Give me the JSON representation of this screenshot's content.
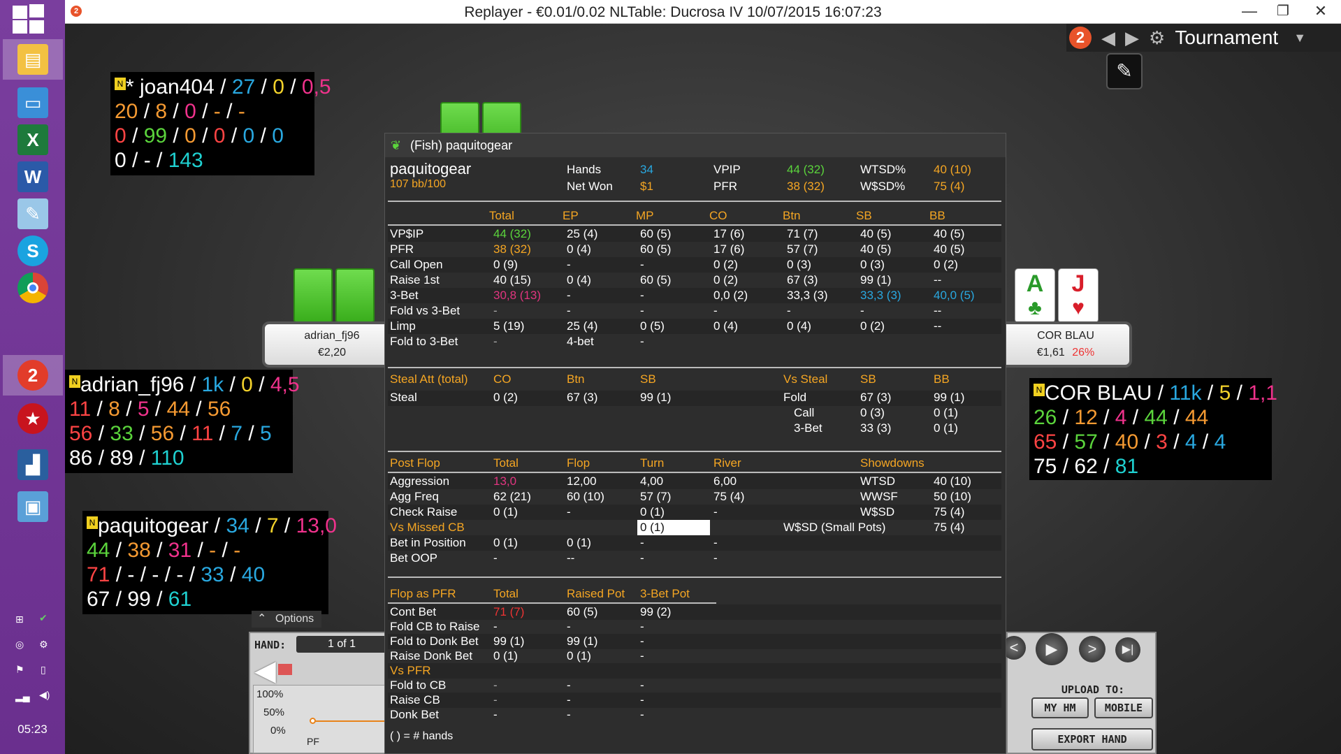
{
  "window": {
    "title": "Replayer - €0.01/0.02 NLTable: Ducrosa IV     10/07/2015 16:07:23",
    "minimize": "—",
    "restore": "❐",
    "close": "✕"
  },
  "taskbar": {
    "clock": "05:23",
    "apps": [
      "file-explorer-icon",
      "remote-desktop-icon",
      "excel-icon",
      "word-icon",
      "notepad-icon",
      "skype-icon",
      "chrome-icon",
      "holdem-manager-icon",
      "pokerstars-icon",
      "chart-app-icon",
      "photos-icon"
    ]
  },
  "toolbar": {
    "badge": "2",
    "mode": "Tournament"
  },
  "huds": {
    "joan": {
      "row1": [
        {
          "t": "* joan404",
          "c": "w"
        },
        {
          "t": " / ",
          "c": "w"
        },
        {
          "t": "27",
          "c": "b"
        },
        {
          "t": " / ",
          "c": "w"
        },
        {
          "t": "0",
          "c": "y"
        },
        {
          "t": " / ",
          "c": "w"
        },
        {
          "t": "0,5",
          "c": "p"
        }
      ],
      "row2": [
        {
          "t": "20",
          "c": "o"
        },
        {
          "t": " / ",
          "c": "w"
        },
        {
          "t": "8",
          "c": "o"
        },
        {
          "t": " / ",
          "c": "w"
        },
        {
          "t": "0",
          "c": "p"
        },
        {
          "t": " / ",
          "c": "w"
        },
        {
          "t": "-",
          "c": "o"
        },
        {
          "t": " / ",
          "c": "w"
        },
        {
          "t": "-",
          "c": "o"
        }
      ],
      "row3": [
        {
          "t": "0",
          "c": "r"
        },
        {
          "t": " / ",
          "c": "w"
        },
        {
          "t": "99",
          "c": "g"
        },
        {
          "t": " / ",
          "c": "w"
        },
        {
          "t": "0",
          "c": "o"
        },
        {
          "t": " / ",
          "c": "w"
        },
        {
          "t": "0",
          "c": "r"
        },
        {
          "t": " / ",
          "c": "w"
        },
        {
          "t": "0",
          "c": "b"
        },
        {
          "t": " / ",
          "c": "w"
        },
        {
          "t": "0",
          "c": "b"
        }
      ],
      "row4": [
        {
          "t": "0",
          "c": "w"
        },
        {
          "t": " / - / ",
          "c": "w"
        },
        {
          "t": "143",
          "c": "c"
        }
      ]
    },
    "adrian": {
      "row1": [
        {
          "t": "adrian_fj96",
          "c": "w"
        },
        {
          "t": " / ",
          "c": "w"
        },
        {
          "t": "1k",
          "c": "b"
        },
        {
          "t": " / ",
          "c": "w"
        },
        {
          "t": "0",
          "c": "y"
        },
        {
          "t": " / ",
          "c": "w"
        },
        {
          "t": "4,5",
          "c": "p"
        }
      ],
      "row2": [
        {
          "t": "11",
          "c": "r"
        },
        {
          "t": " / ",
          "c": "w"
        },
        {
          "t": "8",
          "c": "o"
        },
        {
          "t": " / ",
          "c": "w"
        },
        {
          "t": "5",
          "c": "p"
        },
        {
          "t": " / ",
          "c": "w"
        },
        {
          "t": "44",
          "c": "o"
        },
        {
          "t": " / ",
          "c": "w"
        },
        {
          "t": "56",
          "c": "o"
        }
      ],
      "row3": [
        {
          "t": "56",
          "c": "r"
        },
        {
          "t": " / ",
          "c": "w"
        },
        {
          "t": "33",
          "c": "g"
        },
        {
          "t": " / ",
          "c": "w"
        },
        {
          "t": "56",
          "c": "o"
        },
        {
          "t": " / ",
          "c": "w"
        },
        {
          "t": "11",
          "c": "r"
        },
        {
          "t": " / ",
          "c": "w"
        },
        {
          "t": "7",
          "c": "b"
        },
        {
          "t": " / ",
          "c": "w"
        },
        {
          "t": "5",
          "c": "b"
        }
      ],
      "row4": [
        {
          "t": "86",
          "c": "w"
        },
        {
          "t": " / ",
          "c": "w"
        },
        {
          "t": "89",
          "c": "w"
        },
        {
          "t": " / ",
          "c": "w"
        },
        {
          "t": "110",
          "c": "c"
        }
      ]
    },
    "paquito": {
      "row1": [
        {
          "t": "paquitogear",
          "c": "w"
        },
        {
          "t": " / ",
          "c": "w"
        },
        {
          "t": "34",
          "c": "b"
        },
        {
          "t": " / ",
          "c": "w"
        },
        {
          "t": "7",
          "c": "y"
        },
        {
          "t": " / ",
          "c": "w"
        },
        {
          "t": "13,0",
          "c": "p"
        }
      ],
      "row2": [
        {
          "t": "44",
          "c": "g"
        },
        {
          "t": " / ",
          "c": "w"
        },
        {
          "t": "38",
          "c": "o"
        },
        {
          "t": " / ",
          "c": "w"
        },
        {
          "t": "31",
          "c": "p"
        },
        {
          "t": " / ",
          "c": "w"
        },
        {
          "t": "-",
          "c": "o"
        },
        {
          "t": " / ",
          "c": "w"
        },
        {
          "t": "-",
          "c": "o"
        }
      ],
      "row3": [
        {
          "t": "71",
          "c": "r"
        },
        {
          "t": " / - / - / - / ",
          "c": "w"
        },
        {
          "t": "33",
          "c": "b"
        },
        {
          "t": " / ",
          "c": "w"
        },
        {
          "t": "40",
          "c": "b"
        }
      ],
      "row4": [
        {
          "t": "67",
          "c": "w"
        },
        {
          "t": " / ",
          "c": "w"
        },
        {
          "t": "99",
          "c": "w"
        },
        {
          "t": " / ",
          "c": "w"
        },
        {
          "t": "61",
          "c": "c"
        }
      ]
    },
    "cor": {
      "row1": [
        {
          "t": "COR BLAU",
          "c": "w"
        },
        {
          "t": " / ",
          "c": "w"
        },
        {
          "t": "11k",
          "c": "b"
        },
        {
          "t": " / ",
          "c": "w"
        },
        {
          "t": "5",
          "c": "y"
        },
        {
          "t": " / ",
          "c": "w"
        },
        {
          "t": "1,1",
          "c": "p"
        }
      ],
      "row2": [
        {
          "t": "26",
          "c": "g"
        },
        {
          "t": " / ",
          "c": "w"
        },
        {
          "t": "12",
          "c": "o"
        },
        {
          "t": " / ",
          "c": "w"
        },
        {
          "t": "4",
          "c": "p"
        },
        {
          "t": " / ",
          "c": "w"
        },
        {
          "t": "44",
          "c": "g"
        },
        {
          "t": " / ",
          "c": "w"
        },
        {
          "t": "44",
          "c": "o"
        }
      ],
      "row3": [
        {
          "t": "65",
          "c": "r"
        },
        {
          "t": " / ",
          "c": "w"
        },
        {
          "t": "57",
          "c": "g"
        },
        {
          "t": " / ",
          "c": "w"
        },
        {
          "t": "40",
          "c": "o"
        },
        {
          "t": " / ",
          "c": "w"
        },
        {
          "t": "3",
          "c": "r"
        },
        {
          "t": " / ",
          "c": "w"
        },
        {
          "t": "4",
          "c": "b"
        },
        {
          "t": " / ",
          "c": "w"
        },
        {
          "t": "4",
          "c": "b"
        }
      ],
      "row4": [
        {
          "t": "75",
          "c": "w"
        },
        {
          "t": " / ",
          "c": "w"
        },
        {
          "t": "62",
          "c": "w"
        },
        {
          "t": " / ",
          "c": "w"
        },
        {
          "t": "81",
          "c": "c"
        }
      ]
    }
  },
  "seats": {
    "adrian": {
      "name": "adrian_fj96",
      "stack": "€2,20"
    },
    "cor": {
      "name": "COR BLAU",
      "stack": "€1,61",
      "pct": "26%",
      "card1_rank": "A",
      "card1_suit": "♣",
      "card2_rank": "J",
      "card2_suit": "♥"
    }
  },
  "popup": {
    "title": "(Fish) paquitogear",
    "player": "paquitogear",
    "winrate": "107 bb/100",
    "summary": [
      {
        "l": "Hands",
        "v": "34",
        "vc": "blue"
      },
      {
        "l": "Net Won",
        "v": "$1",
        "vc": "ora"
      },
      {
        "l": "VPIP",
        "v": "44 (32)",
        "vc": "grn"
      },
      {
        "l": "PFR",
        "v": "38 (32)",
        "vc": "ora"
      },
      {
        "l": "WTSD%",
        "v": "40 (10)",
        "vc": "ora"
      },
      {
        "l": "W$SD%",
        "v": "75 (4)",
        "vc": "ora"
      }
    ],
    "pre_headers": [
      "Total",
      "EP",
      "MP",
      "CO",
      "Btn",
      "SB",
      "BB"
    ],
    "pre_rows": [
      {
        "label": "VP$IP",
        "cells": [
          {
            "t": "44 (32)",
            "c": "grn"
          },
          {
            "t": "25 (4)"
          },
          {
            "t": "60 (5)"
          },
          {
            "t": "17 (6)"
          },
          {
            "t": "71 (7)"
          },
          {
            "t": "40 (5)"
          },
          {
            "t": "40 (5)"
          }
        ]
      },
      {
        "label": "PFR",
        "cells": [
          {
            "t": "38 (32)",
            "c": "ora"
          },
          {
            "t": "0 (4)"
          },
          {
            "t": "60 (5)"
          },
          {
            "t": "17 (6)"
          },
          {
            "t": "57 (7)"
          },
          {
            "t": "40 (5)"
          },
          {
            "t": "40 (5)"
          }
        ]
      },
      {
        "label": "Call Open",
        "cells": [
          {
            "t": "0 (9)"
          },
          {
            "t": "-"
          },
          {
            "t": "-"
          },
          {
            "t": "0 (2)"
          },
          {
            "t": "0 (3)"
          },
          {
            "t": "0 (3)"
          },
          {
            "t": "0 (2)"
          }
        ]
      },
      {
        "label": "Raise 1st",
        "cells": [
          {
            "t": "40 (15)"
          },
          {
            "t": "0 (4)"
          },
          {
            "t": "60 (5)"
          },
          {
            "t": "0 (2)"
          },
          {
            "t": "67 (3)"
          },
          {
            "t": "99 (1)"
          },
          {
            "t": "--"
          }
        ]
      },
      {
        "label": "3-Bet",
        "cells": [
          {
            "t": "30,8 (13)",
            "c": "pink"
          },
          {
            "t": "-"
          },
          {
            "t": "-"
          },
          {
            "t": "0,0 (2)"
          },
          {
            "t": "33,3 (3)"
          },
          {
            "t": "33,3 (3)",
            "c": "blue"
          },
          {
            "t": "40,0 (5)",
            "c": "blue"
          }
        ]
      },
      {
        "label": "Fold vs 3-Bet",
        "cells": [
          {
            "t": "-",
            "c": "gray"
          },
          {
            "t": "-"
          },
          {
            "t": "-"
          },
          {
            "t": "-"
          },
          {
            "t": "-"
          },
          {
            "t": "-"
          },
          {
            "t": "--"
          }
        ]
      },
      {
        "label": "Limp",
        "cells": [
          {
            "t": "5 (19)"
          },
          {
            "t": "25 (4)"
          },
          {
            "t": "0 (5)"
          },
          {
            "t": "0 (4)"
          },
          {
            "t": "0 (4)"
          },
          {
            "t": "0 (2)"
          },
          {
            "t": "--"
          }
        ]
      },
      {
        "label": "Fold to 3-Bet",
        "cells": [
          {
            "t": "-",
            "c": "gray"
          },
          {
            "t": "4-bet"
          },
          {
            "t": "-"
          },
          {
            "t": ""
          },
          {
            "t": ""
          },
          {
            "t": ""
          },
          {
            "t": ""
          }
        ]
      }
    ],
    "steal": {
      "headers": [
        "Steal Att (total)",
        "CO",
        "Btn",
        "SB",
        "Vs Steal",
        "SB",
        "BB"
      ],
      "steal_row": {
        "label": "Steal",
        "cells": [
          "0 (2)",
          "67 (3)",
          "99 (1)"
        ]
      },
      "vs_rows": [
        {
          "label": "Fold",
          "sb": "67 (3)",
          "bb": "99 (1)"
        },
        {
          "label": "Call",
          "sb": "0 (3)",
          "bb": "0 (1)"
        },
        {
          "label": "3-Bet",
          "sb": "33 (3)",
          "bb": "0 (1)"
        }
      ]
    },
    "post": {
      "headers": [
        "Post Flop",
        "Total",
        "Flop",
        "Turn",
        "River",
        "Showdowns"
      ],
      "rows": [
        {
          "label": "Aggression",
          "lc": "",
          "cells": [
            {
              "t": "13,0",
              "c": "pink"
            },
            {
              "t": "12,00"
            },
            {
              "t": "4,00"
            },
            {
              "t": "6,00"
            }
          ]
        },
        {
          "label": "Agg Freq",
          "lc": "",
          "cells": [
            {
              "t": "62 (21)"
            },
            {
              "t": "60 (10)"
            },
            {
              "t": "57 (7)"
            },
            {
              "t": "75 (4)"
            }
          ]
        },
        {
          "label": "Check Raise",
          "lc": "",
          "cells": [
            {
              "t": "0 (1)"
            },
            {
              "t": "-"
            },
            {
              "t": "0 (1)"
            },
            {
              "t": "-"
            }
          ]
        },
        {
          "label": "Vs Missed CB",
          "lc": "ora",
          "cells": [
            {
              "t": ""
            },
            {
              "t": ""
            },
            {
              "t": "0 (1)",
              "c": "hl"
            },
            {
              "t": ""
            }
          ]
        },
        {
          "label": "Bet in Position",
          "lc": "",
          "cells": [
            {
              "t": "0 (1)"
            },
            {
              "t": "0 (1)"
            },
            {
              "t": "-"
            },
            {
              "t": "-"
            }
          ]
        },
        {
          "label": "Bet OOP",
          "lc": "",
          "cells": [
            {
              "t": "-"
            },
            {
              "t": "--"
            },
            {
              "t": "-"
            },
            {
              "t": "-"
            }
          ]
        }
      ],
      "showdowns": [
        {
          "label": "WTSD",
          "v": "40 (10)"
        },
        {
          "label": "WWSF",
          "v": "50 (10)"
        },
        {
          "label": "W$SD",
          "v": "75 (4)"
        },
        {
          "label": "W$SD (Small Pots)",
          "v": "75 (4)"
        }
      ]
    },
    "flop": {
      "headers": [
        "Flop as PFR",
        "Total",
        "Raised Pot",
        "3-Bet Pot"
      ],
      "rows": [
        {
          "label": "Cont Bet",
          "lc": "",
          "cells": [
            {
              "t": "71 (7)",
              "c": "red"
            },
            {
              "t": "60 (5)"
            },
            {
              "t": "99 (2)"
            }
          ]
        },
        {
          "label": "Fold CB to Raise",
          "lc": "",
          "cells": [
            {
              "t": "-"
            },
            {
              "t": "-"
            },
            {
              "t": "-"
            }
          ]
        },
        {
          "label": "Fold to Donk Bet",
          "lc": "",
          "cells": [
            {
              "t": "99 (1)"
            },
            {
              "t": "99 (1)"
            },
            {
              "t": "-"
            }
          ]
        },
        {
          "label": "Raise Donk Bet",
          "lc": "",
          "cells": [
            {
              "t": "0 (1)"
            },
            {
              "t": "0 (1)"
            },
            {
              "t": "-"
            }
          ]
        },
        {
          "label": "Vs PFR",
          "lc": "ora",
          "cells": [
            {
              "t": ""
            },
            {
              "t": ""
            },
            {
              "t": ""
            }
          ]
        },
        {
          "label": "Fold to CB",
          "lc": "",
          "cells": [
            {
              "t": "-",
              "c": "gray"
            },
            {
              "t": "-"
            },
            {
              "t": "-"
            }
          ]
        },
        {
          "label": "Raise CB",
          "lc": "",
          "cells": [
            {
              "t": "-",
              "c": "gray"
            },
            {
              "t": "-"
            },
            {
              "t": "-"
            }
          ]
        },
        {
          "label": "Donk Bet",
          "lc": "",
          "cells": [
            {
              "t": "-"
            },
            {
              "t": "-"
            },
            {
              "t": "-"
            }
          ]
        }
      ]
    },
    "footnote": "( ) = # hands"
  },
  "replay": {
    "options": "Options",
    "hand_label": "HAND:",
    "hand_value": "1 of 1",
    "graph_labels": [
      "100%",
      "50%",
      "0%"
    ],
    "street": "PF",
    "upload_label": "UPLOAD TO:",
    "my_hm": "MY HM",
    "mobile": "MOBILE",
    "export": "EXPORT HAND"
  }
}
